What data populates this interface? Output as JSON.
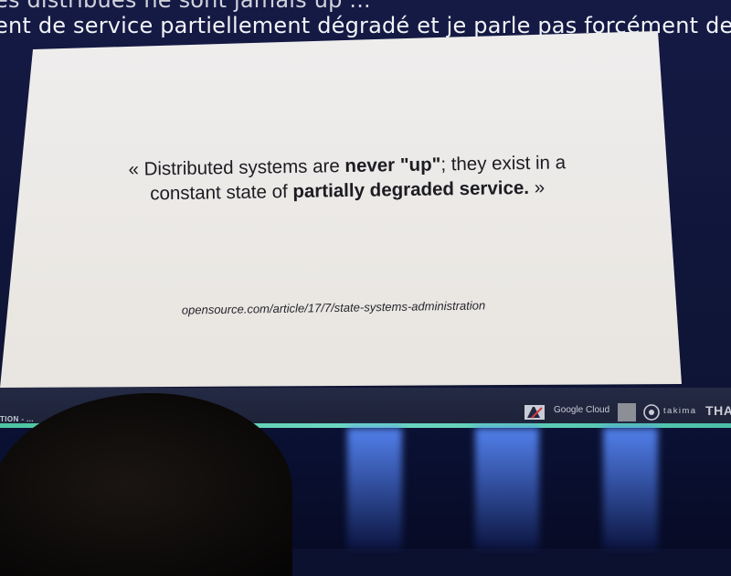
{
  "subtitles": {
    "line1": "es distribués ne sont jamais up ...",
    "line2": "ent de service partiellement dégradé et je parle pas forcément de p"
  },
  "slide": {
    "quote_part1": "« Distributed systems are ",
    "quote_bold1": "never \"up\"",
    "quote_part2": "; they exist in a constant state of ",
    "quote_bold2": "partially degraded service.",
    "quote_part3": " »",
    "source": "opensource.com/article/17/7/state-systems-administration"
  },
  "bottom_bar": {
    "label": "TION - ...",
    "sponsors": {
      "google_cloud": "Google Cloud",
      "takima": "takima",
      "tha": "THA"
    }
  },
  "colors": {
    "screen_background": "#141a44",
    "slide_background": "#efeeee",
    "accent_line": "#4cc4a0"
  }
}
